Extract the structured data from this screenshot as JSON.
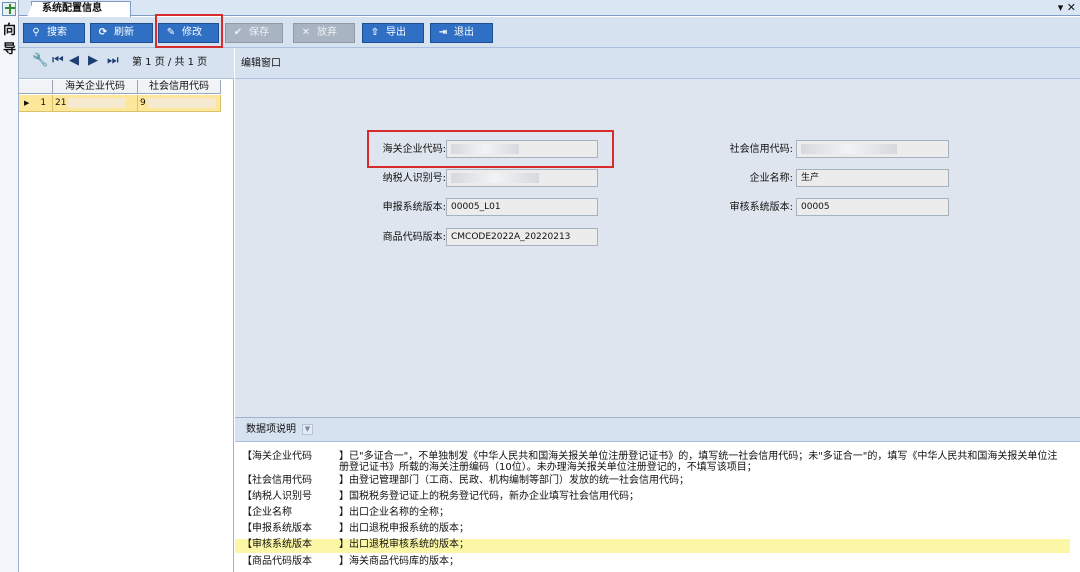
{
  "tab": {
    "title": "系统配置信息",
    "window_controls": "▾ ✕"
  },
  "wizard": {
    "label": "向导"
  },
  "toolbar": {
    "search": "搜索",
    "refresh": "刷新",
    "edit": "修改",
    "save": "保存",
    "discard": "放弃",
    "export": "导出",
    "exit": "退出"
  },
  "pager": {
    "text": "第 1 页 / 共 1 页"
  },
  "grid": {
    "headers": [
      "海关企业代码",
      "社会信用代码"
    ],
    "rows": [
      {
        "no": "1",
        "customs_code": "21",
        "credit_code": "9"
      }
    ]
  },
  "edit_title": "编辑窗口",
  "form": {
    "customs_code_label": "海关企业代码:",
    "credit_code_label": "社会信用代码:",
    "taxpayer_label": "纳税人识别号:",
    "company_label": "企业名称:",
    "company_value": "生产",
    "decl_version_label": "申报系统版本:",
    "decl_version_value": "00005_L01",
    "review_version_label": "审核系统版本:",
    "review_version_value": "00005",
    "goods_version_label": "商品代码版本:",
    "goods_version_value": "CMCODE2022A_20220213"
  },
  "desc_title": "数据项说明",
  "desc": [
    {
      "key": "【海关企业代码",
      "text": "】已\"多证合一\"，不单独制发《中华人民共和国海关报关单位注册登记证书》的，填写统一社会信用代码；未\"多证合一\"的，填写《中华人民共和国海关报关单位注册登记证书》所载的海关注册编码（10位）。未办理海关报关单位注册登记的，不填写该项目；"
    },
    {
      "key": "【社会信用代码",
      "text": "】由登记管理部门（工商、民政、机构编制等部门）发放的统一社会信用代码；"
    },
    {
      "key": "【纳税人识别号",
      "text": "】国税税务登记证上的税务登记代码，新办企业填写社会信用代码；"
    },
    {
      "key": "【企业名称",
      "text": "】出口企业名称的全称；"
    },
    {
      "key": "【申报系统版本",
      "text": "】出口退税申报系统的版本；"
    },
    {
      "key": "【审核系统版本",
      "text": "】出口退税审核系统的版本；"
    },
    {
      "key": "【商品代码版本",
      "text": "】海关商品代码库的版本；"
    }
  ]
}
